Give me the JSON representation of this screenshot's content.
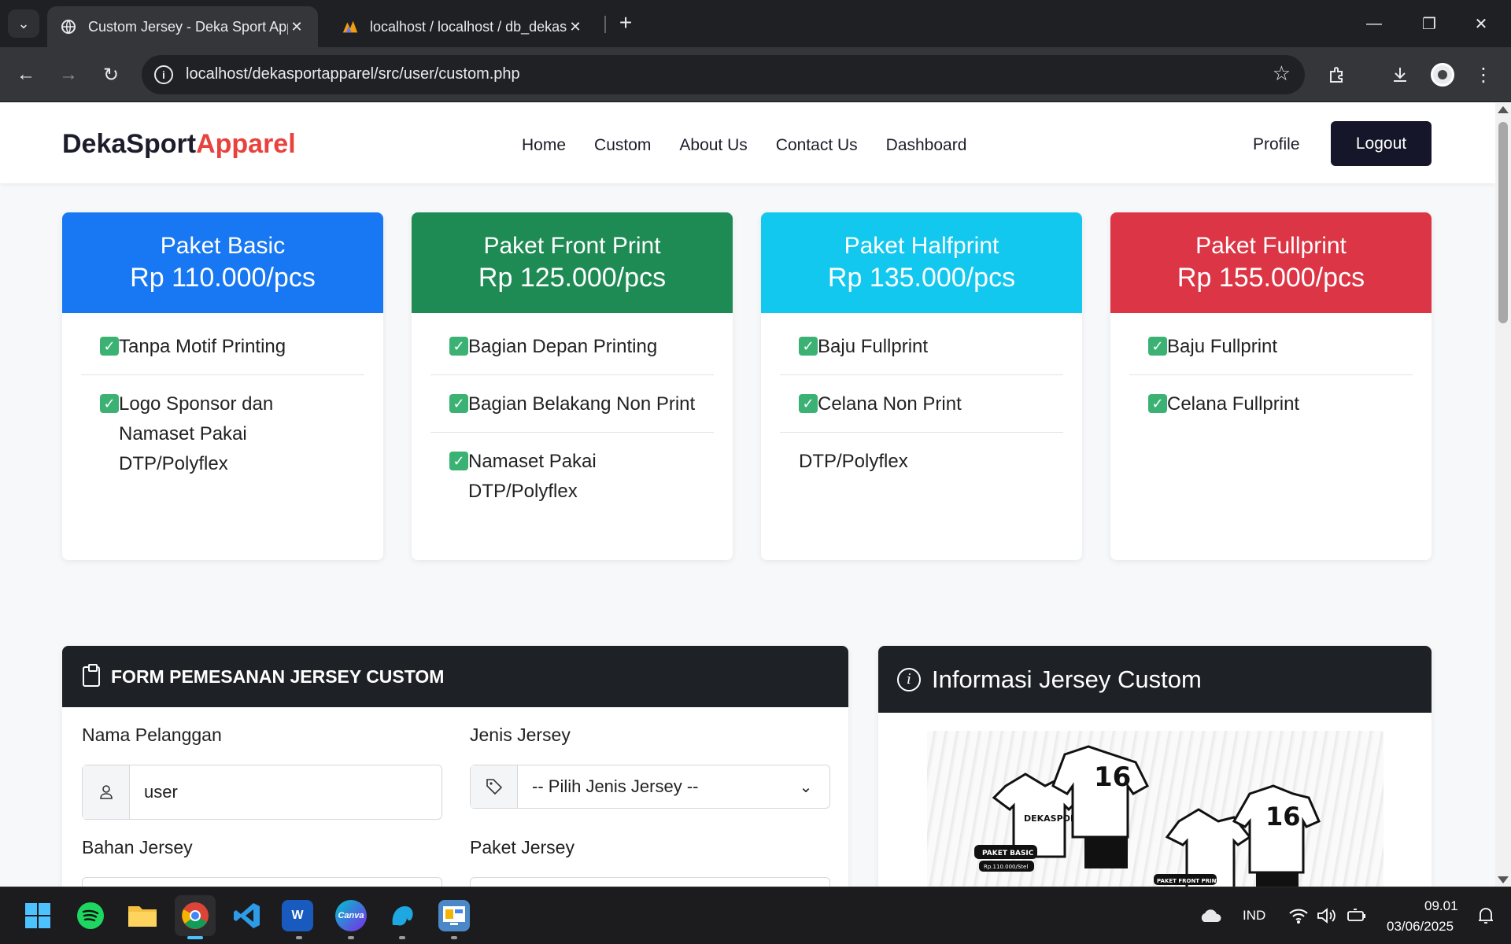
{
  "browser": {
    "tabs": [
      {
        "title": "Custom Jersey - Deka Sport Apparel",
        "icon": "globe-icon"
      },
      {
        "title": "localhost / localhost / db_dekasport",
        "icon": "phpmyadmin-icon"
      }
    ],
    "url": "localhost/dekasportapparel/src/user/custom.php"
  },
  "navbar": {
    "brand_primary": "DekaSport",
    "brand_accent": "Apparel",
    "links": [
      "Home",
      "Custom",
      "About Us",
      "Contact Us",
      "Dashboard"
    ],
    "profile": "Profile",
    "logout": "Logout"
  },
  "packages": [
    {
      "name": "Paket Basic",
      "price": "Rp 110.000/pcs",
      "color": "#1877f2",
      "items": [
        {
          "text": "Tanpa Motif Printing",
          "checked": true
        },
        {
          "text": "Logo Sponsor dan Namaset Pakai DTP/Polyflex",
          "checked": true
        }
      ]
    },
    {
      "name": "Paket Front Print",
      "price": "Rp 125.000/pcs",
      "color": "#1e8a54",
      "items": [
        {
          "text": "Bagian Depan Printing",
          "checked": true
        },
        {
          "text": "Bagian Belakang Non Print",
          "checked": true
        },
        {
          "text": "Namaset Pakai DTP/Polyflex",
          "checked": true
        }
      ]
    },
    {
      "name": "Paket Halfprint",
      "price": "Rp 135.000/pcs",
      "color": "#12c8ef",
      "items": [
        {
          "text": "Baju Fullprint",
          "checked": true
        },
        {
          "text": "Celana Non Print",
          "checked": true
        },
        {
          "text": "DTP/Polyflex",
          "checked": false
        }
      ]
    },
    {
      "name": "Paket Fullprint",
      "price": "Rp 155.000/pcs",
      "color": "#dc3545",
      "items": [
        {
          "text": "Baju Fullprint",
          "checked": true
        },
        {
          "text": "Celana Fullprint",
          "checked": true
        }
      ]
    }
  ],
  "form": {
    "title": "FORM PEMESANAN JERSEY CUSTOM",
    "nama_label": "Nama Pelanggan",
    "nama_value": "user",
    "jenis_label": "Jenis Jersey",
    "jenis_value": "-- Pilih Jenis Jersey --",
    "bahan_label": "Bahan Jersey",
    "paket_label": "Paket Jersey"
  },
  "info": {
    "title": "Informasi Jersey Custom",
    "image_badges": {
      "brand": "DEKASPORT",
      "number": "16",
      "basic": "PAKET BASIC",
      "basic_price": "Rp.110.000/Stel",
      "front": "PAKET FRONT PRINT"
    }
  },
  "taskbar": {
    "language": "IND",
    "time": "09.01",
    "date": "03/06/2025"
  }
}
